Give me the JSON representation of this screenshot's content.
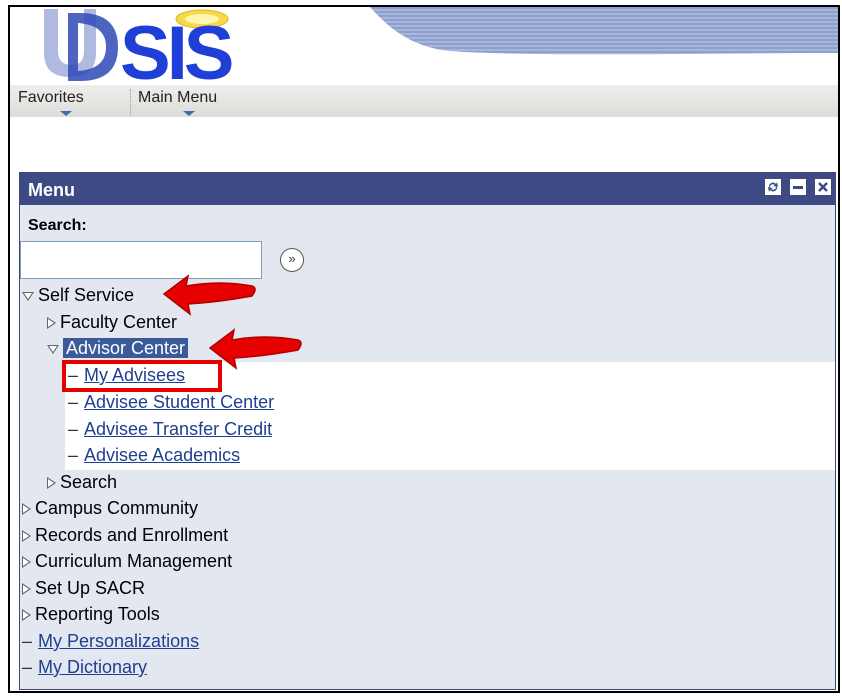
{
  "logo": {
    "text": "SIS",
    "mark": "UD"
  },
  "nav": {
    "favorites": "Favorites",
    "main_menu": "Main Menu"
  },
  "pagelet": {
    "title": "Menu",
    "search_label": "Search:",
    "search_value": "",
    "go_symbol": "»"
  },
  "tree": {
    "self_service": "Self Service",
    "faculty_center": "Faculty Center",
    "advisor_center": "Advisor Center",
    "my_advisees": "My Advisees",
    "advisee_student_center": "Advisee Student Center",
    "advisee_transfer_credit": "Advisee Transfer Credit",
    "advisee_academics": "Advisee Academics",
    "search": "Search",
    "campus_community": "Campus Community",
    "records_enrollment": "Records and Enrollment",
    "curriculum_management": "Curriculum Management",
    "set_up_sacr": "Set Up SACR",
    "reporting_tools": "Reporting Tools",
    "my_personalizations": "My Personalizations",
    "my_dictionary": "My Dictionary"
  },
  "colors": {
    "title_bar": "#3e4a83",
    "pagelet_bg": "#e3e7f0",
    "link": "#1f3f8f",
    "highlight": "#3b5a9a",
    "annotation_red": "#e60000"
  }
}
